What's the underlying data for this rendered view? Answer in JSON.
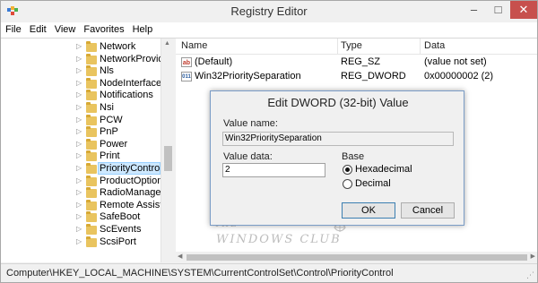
{
  "window": {
    "title": "Registry Editor",
    "controls": {
      "minimize": "–",
      "maximize": "□",
      "close": "✕"
    }
  },
  "menu": [
    "File",
    "Edit",
    "View",
    "Favorites",
    "Help"
  ],
  "tree": {
    "items": [
      {
        "label": "Network"
      },
      {
        "label": "NetworkProvider"
      },
      {
        "label": "Nls"
      },
      {
        "label": "NodeInterfaces"
      },
      {
        "label": "Notifications"
      },
      {
        "label": "Nsi"
      },
      {
        "label": "PCW"
      },
      {
        "label": "PnP"
      },
      {
        "label": "Power"
      },
      {
        "label": "Print"
      },
      {
        "label": "PriorityControl",
        "selected": true
      },
      {
        "label": "ProductOptions"
      },
      {
        "label": "RadioManageme"
      },
      {
        "label": "Remote Assistan"
      },
      {
        "label": "SafeBoot"
      },
      {
        "label": "ScEvents"
      },
      {
        "label": "ScsiPort"
      }
    ]
  },
  "list": {
    "columns": {
      "name": "Name",
      "type": "Type",
      "data": "Data"
    },
    "rows": [
      {
        "icon": "string-value-icon",
        "icon_text": "ab",
        "name": "(Default)",
        "type": "REG_SZ",
        "data": "(value not set)"
      },
      {
        "icon": "dword-value-icon",
        "icon_text": "011",
        "name": "Win32PrioritySeparation",
        "type": "REG_DWORD",
        "data": "0x00000002 (2)"
      }
    ]
  },
  "dialog": {
    "title": "Edit DWORD (32-bit) Value",
    "value_name_label": "Value name:",
    "value_name": "Win32PrioritySeparation",
    "value_data_label": "Value data:",
    "value_data": "2",
    "base_label": "Base",
    "base_options": [
      {
        "label": "Hexadecimal",
        "checked": true
      },
      {
        "label": "Decimal",
        "checked": false
      }
    ],
    "ok_label": "OK",
    "cancel_label": "Cancel"
  },
  "watermark": {
    "line1": "THE",
    "line2": "WINDOWS CLUB"
  },
  "status": {
    "path": "Computer\\HKEY_LOCAL_MACHINE\\SYSTEM\\CurrentControlSet\\Control\\PriorityControl"
  },
  "colors": {
    "selection": "#cde8ff",
    "close_button": "#c7504d",
    "dialog_border": "#7a9cc6"
  }
}
